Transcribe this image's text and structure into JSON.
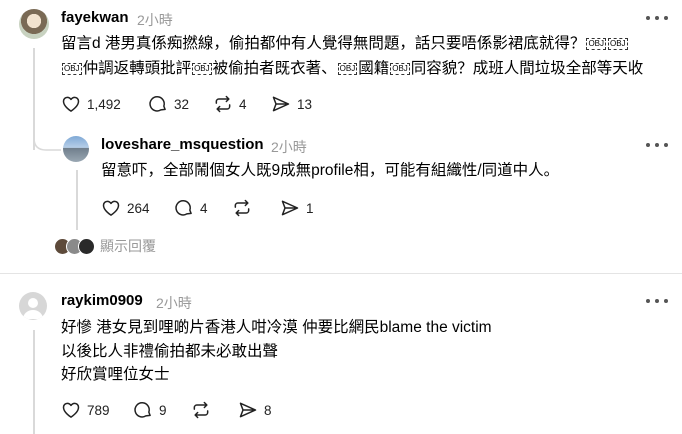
{
  "threads": [
    {
      "username": "fayekwan",
      "time": "2小時",
      "lines": [
        [
          "留言d 港男真係痴撚線，偷拍都仲有人覺得無問題，話只要唔係影裙底就得？",
          "OBJ",
          "OBJ"
        ],
        [
          "OBJ",
          "仲調返轉頭批評",
          "OBJ",
          "被偷拍者既衣著、",
          "OBJ",
          "國籍",
          "OBJ",
          "同容貌？成班人間垃圾全部等天收"
        ]
      ],
      "likes": "1,492",
      "comments": "32",
      "reposts": "4",
      "shares": "13"
    },
    {
      "username": "loveshare_msquestion",
      "time": "2小時",
      "text": "留意吓，全部鬧個女人既9成無profile相，可能有組織性/同道中人。",
      "likes": "264",
      "comments": "4",
      "reposts": "",
      "shares": "1"
    },
    {
      "username": "raykim0909",
      "time": "2小時",
      "lines": [
        "好慘 港女見到哩啲片香港人咁冷漠 仲要比網民blame the victim",
        "以後比人非禮偷拍都未必敢出聲",
        "好欣賞哩位女士"
      ],
      "likes": "789",
      "comments": "9",
      "reposts": "",
      "shares": "8"
    }
  ],
  "show_replies_label": "顯示回覆",
  "icons": [
    "heart-icon",
    "comment-icon",
    "repost-icon",
    "share-icon",
    "more-icon"
  ],
  "colors": {
    "text": "#000000",
    "muted": "#999999",
    "divider": "#e4e4e4"
  }
}
